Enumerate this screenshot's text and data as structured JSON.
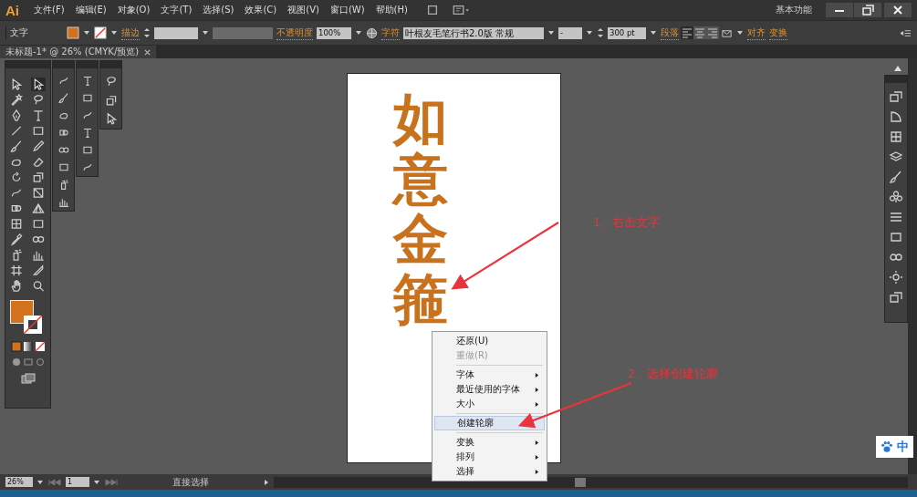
{
  "app": {
    "logo": "Ai"
  },
  "menu": [
    {
      "label": "文件(F)"
    },
    {
      "label": "编辑(E)"
    },
    {
      "label": "对象(O)"
    },
    {
      "label": "文字(T)"
    },
    {
      "label": "选择(S)"
    },
    {
      "label": "效果(C)"
    },
    {
      "label": "视图(V)"
    },
    {
      "label": "窗口(W)"
    },
    {
      "label": "帮助(H)"
    }
  ],
  "workspace": "基本功能",
  "control_bar": {
    "selection_label": "文字",
    "stroke_label": "描边",
    "opacity_label": "不透明度",
    "opacity": "100%",
    "character_label": "字符",
    "font": "叶根友毛笔行书2.0版 常规",
    "font_style": "-",
    "font_size": "300 pt",
    "paragraph_label": "段落",
    "align_label": "对齐",
    "transform_label": "变换"
  },
  "document_tab": {
    "title": "未标题-1* @ 26% (CMYK/预览)"
  },
  "artboard": {
    "text": "如意金箍"
  },
  "context_menu": [
    {
      "kind": "item",
      "label": "还原(U)",
      "disabled": false,
      "submenu": false,
      "selected": false
    },
    {
      "kind": "item",
      "label": "重做(R)",
      "disabled": true,
      "submenu": false,
      "selected": false
    },
    {
      "kind": "separator"
    },
    {
      "kind": "item",
      "label": "字体",
      "disabled": false,
      "submenu": true,
      "selected": false
    },
    {
      "kind": "item",
      "label": "最近使用的字体",
      "disabled": false,
      "submenu": true,
      "selected": false
    },
    {
      "kind": "item",
      "label": "大小",
      "disabled": false,
      "submenu": true,
      "selected": false
    },
    {
      "kind": "separator"
    },
    {
      "kind": "item",
      "label": "创建轮廓",
      "disabled": false,
      "submenu": false,
      "selected": true
    },
    {
      "kind": "separator"
    },
    {
      "kind": "item",
      "label": "变换",
      "disabled": false,
      "submenu": true,
      "selected": false
    },
    {
      "kind": "item",
      "label": "排列",
      "disabled": false,
      "submenu": true,
      "selected": false
    },
    {
      "kind": "item",
      "label": "选择",
      "disabled": false,
      "submenu": true,
      "selected": false
    }
  ],
  "annotations": [
    {
      "text": "1、右击文字"
    },
    {
      "text": "2、选择创建轮廓"
    }
  ],
  "status_bar": {
    "zoom": "26%",
    "page": "1",
    "tool": "直接选择"
  },
  "ime": {
    "label": "中"
  }
}
